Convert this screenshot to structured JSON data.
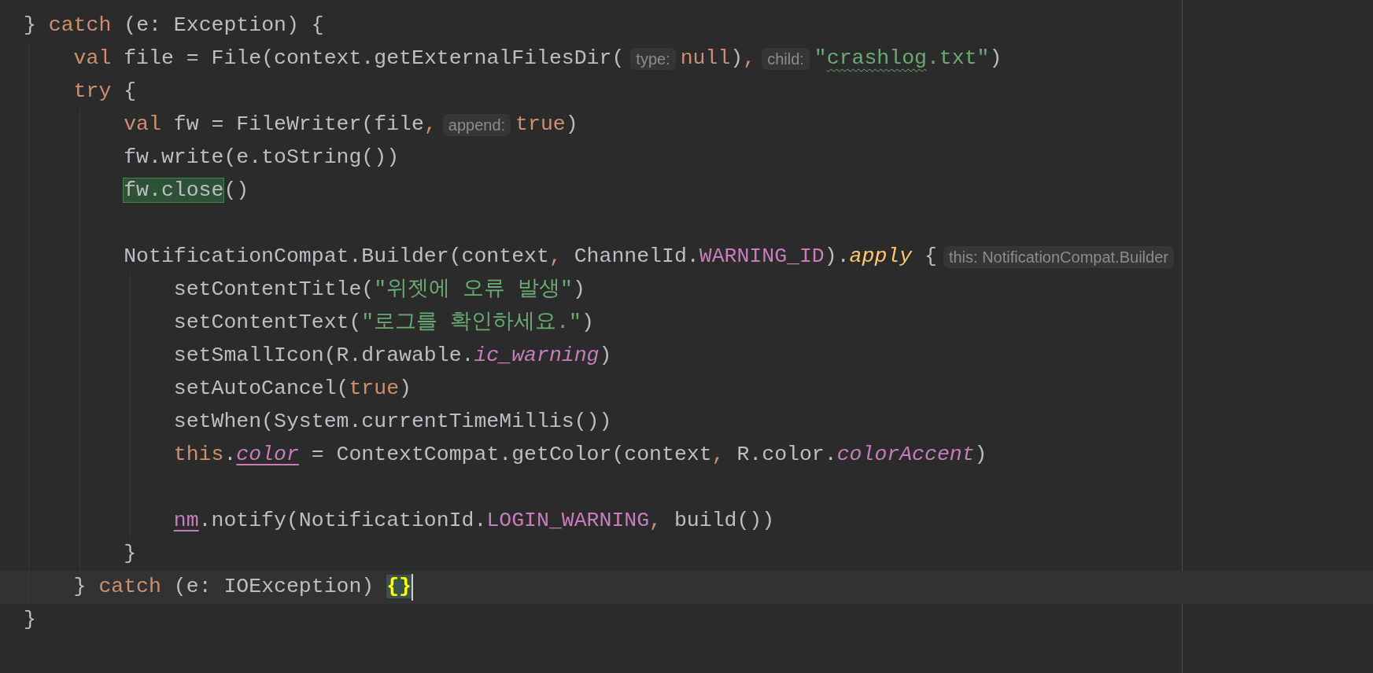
{
  "editor": {
    "lines": [
      {
        "current": false,
        "segments": [
          {
            "kind": "code",
            "tokens": [
              {
                "text": "} ",
                "kind": "plain"
              },
              {
                "text": "catch",
                "kind": "keyword"
              },
              {
                "text": " (e: Exception) {",
                "kind": "plain"
              }
            ]
          }
        ],
        "children": [
          {
            "current": false,
            "segments": [
              {
                "kind": "code",
                "tokens": [
                  {
                    "text": "val",
                    "kind": "keyword"
                  },
                  {
                    "text": " file = File(context.getExternalFilesDir(",
                    "kind": "plain"
                  }
                ]
              },
              {
                "kind": "hint",
                "text": "type:"
              },
              {
                "kind": "code",
                "tokens": [
                  {
                    "text": "null",
                    "kind": "keyword"
                  },
                  {
                    "text": ")",
                    "kind": "plain"
                  },
                  {
                    "text": ",",
                    "kind": "keyword"
                  }
                ]
              },
              {
                "kind": "hint",
                "text": "child:"
              },
              {
                "kind": "code",
                "tokens": [
                  {
                    "text": "\"",
                    "kind": "string"
                  },
                  {
                    "text": "crashlog",
                    "kind": "string",
                    "squiggle": true
                  },
                  {
                    "text": ".txt\"",
                    "kind": "string"
                  },
                  {
                    "text": ")",
                    "kind": "plain"
                  }
                ]
              }
            ]
          },
          {
            "current": false,
            "segments": [
              {
                "kind": "code",
                "tokens": [
                  {
                    "text": "try",
                    "kind": "keyword"
                  },
                  {
                    "text": " {",
                    "kind": "plain"
                  }
                ]
              }
            ],
            "children": [
              {
                "current": false,
                "segments": [
                  {
                    "kind": "code",
                    "tokens": [
                      {
                        "text": "val",
                        "kind": "keyword"
                      },
                      {
                        "text": " fw = FileWriter(file",
                        "kind": "plain"
                      },
                      {
                        "text": ",",
                        "kind": "keyword"
                      }
                    ]
                  },
                  {
                    "kind": "hint",
                    "text": "append:"
                  },
                  {
                    "kind": "code",
                    "tokens": [
                      {
                        "text": "true",
                        "kind": "keyword"
                      },
                      {
                        "text": ")",
                        "kind": "plain"
                      }
                    ]
                  }
                ]
              },
              {
                "current": false,
                "segments": [
                  {
                    "kind": "code",
                    "tokens": [
                      {
                        "text": "fw.write(e.toString())",
                        "kind": "plain"
                      }
                    ]
                  }
                ]
              },
              {
                "current": false,
                "segments": [
                  {
                    "kind": "code",
                    "tokens": [
                      {
                        "text": "fw.close",
                        "kind": "plain",
                        "highlighted": true
                      },
                      {
                        "text": "()",
                        "kind": "plain"
                      }
                    ]
                  }
                ]
              },
              {
                "current": false
              },
              {
                "current": false,
                "segments": [
                  {
                    "kind": "code",
                    "tokens": [
                      {
                        "text": "NotificationCompat.Builder(context",
                        "kind": "plain"
                      },
                      {
                        "text": ",",
                        "kind": "keyword"
                      },
                      {
                        "text": " ChannelId.",
                        "kind": "plain"
                      },
                      {
                        "text": "WARNING_ID",
                        "kind": "constant"
                      },
                      {
                        "text": ").",
                        "kind": "plain"
                      },
                      {
                        "text": "apply",
                        "kind": "call"
                      },
                      {
                        "text": " {",
                        "kind": "plain"
                      }
                    ]
                  },
                  {
                    "kind": "hint",
                    "text": "this: NotificationCompat.Builder"
                  }
                ],
                "children": [
                  {
                    "current": false,
                    "segments": [
                      {
                        "kind": "code",
                        "tokens": [
                          {
                            "text": "setContentTitle(",
                            "kind": "plain"
                          },
                          {
                            "text": "\"위젯에 오류 발생\"",
                            "kind": "string"
                          },
                          {
                            "text": ")",
                            "kind": "plain"
                          }
                        ]
                      }
                    ]
                  },
                  {
                    "current": false,
                    "segments": [
                      {
                        "kind": "code",
                        "tokens": [
                          {
                            "text": "setContentText(",
                            "kind": "plain"
                          },
                          {
                            "text": "\"로그를 확인하세요.\"",
                            "kind": "string"
                          },
                          {
                            "text": ")",
                            "kind": "plain"
                          }
                        ]
                      }
                    ]
                  },
                  {
                    "current": false,
                    "segments": [
                      {
                        "kind": "code",
                        "tokens": [
                          {
                            "text": "setSmallIcon(R.drawable.",
                            "kind": "plain"
                          },
                          {
                            "text": "ic_warning",
                            "kind": "member"
                          },
                          {
                            "text": ")",
                            "kind": "plain"
                          }
                        ]
                      }
                    ]
                  },
                  {
                    "current": false,
                    "segments": [
                      {
                        "kind": "code",
                        "tokens": [
                          {
                            "text": "setAutoCancel(",
                            "kind": "plain"
                          },
                          {
                            "text": "true",
                            "kind": "keyword"
                          },
                          {
                            "text": ")",
                            "kind": "plain"
                          }
                        ]
                      }
                    ]
                  },
                  {
                    "current": false,
                    "segments": [
                      {
                        "kind": "code",
                        "tokens": [
                          {
                            "text": "setWhen(System.currentTimeMillis())",
                            "kind": "plain"
                          }
                        ]
                      }
                    ]
                  },
                  {
                    "current": false,
                    "segments": [
                      {
                        "kind": "code",
                        "tokens": [
                          {
                            "text": "this",
                            "kind": "keyword"
                          },
                          {
                            "text": ".",
                            "kind": "plain"
                          },
                          {
                            "text": "color",
                            "kind": "member",
                            "underline": true
                          },
                          {
                            "text": " = ContextCompat.getColor(context",
                            "kind": "plain"
                          },
                          {
                            "text": ",",
                            "kind": "keyword"
                          },
                          {
                            "text": " R.color.",
                            "kind": "plain"
                          },
                          {
                            "text": "colorAccent",
                            "kind": "member"
                          },
                          {
                            "text": ")",
                            "kind": "plain"
                          }
                        ]
                      }
                    ]
                  },
                  {
                    "current": false
                  },
                  {
                    "current": false,
                    "segments": [
                      {
                        "kind": "code",
                        "tokens": [
                          {
                            "text": "nm",
                            "kind": "field",
                            "underline": true
                          },
                          {
                            "text": ".notify(NotificationId.",
                            "kind": "plain"
                          },
                          {
                            "text": "LOGIN_WARNING",
                            "kind": "constant"
                          },
                          {
                            "text": ",",
                            "kind": "keyword"
                          },
                          {
                            "text": " build())",
                            "kind": "plain"
                          }
                        ]
                      }
                    ]
                  }
                ]
              },
              {
                "current": false,
                "segments": [
                  {
                    "kind": "code",
                    "tokens": [
                      {
                        "text": "}",
                        "kind": "plain"
                      }
                    ]
                  }
                ]
              }
            ]
          },
          {
            "current": true,
            "segments": [
              {
                "kind": "code",
                "tokens": [
                  {
                    "text": "} ",
                    "kind": "plain"
                  },
                  {
                    "text": "catch",
                    "kind": "keyword"
                  },
                  {
                    "text": " (e: IOException) ",
                    "kind": "plain"
                  },
                  {
                    "text": "{}",
                    "kind": "plain",
                    "brace_match": true
                  }
                ]
              },
              {
                "kind": "caret"
              }
            ]
          }
        ]
      },
      {
        "current": false,
        "segments": [
          {
            "kind": "code",
            "tokens": [
              {
                "text": "}",
                "kind": "plain"
              }
            ]
          }
        ]
      }
    ]
  }
}
